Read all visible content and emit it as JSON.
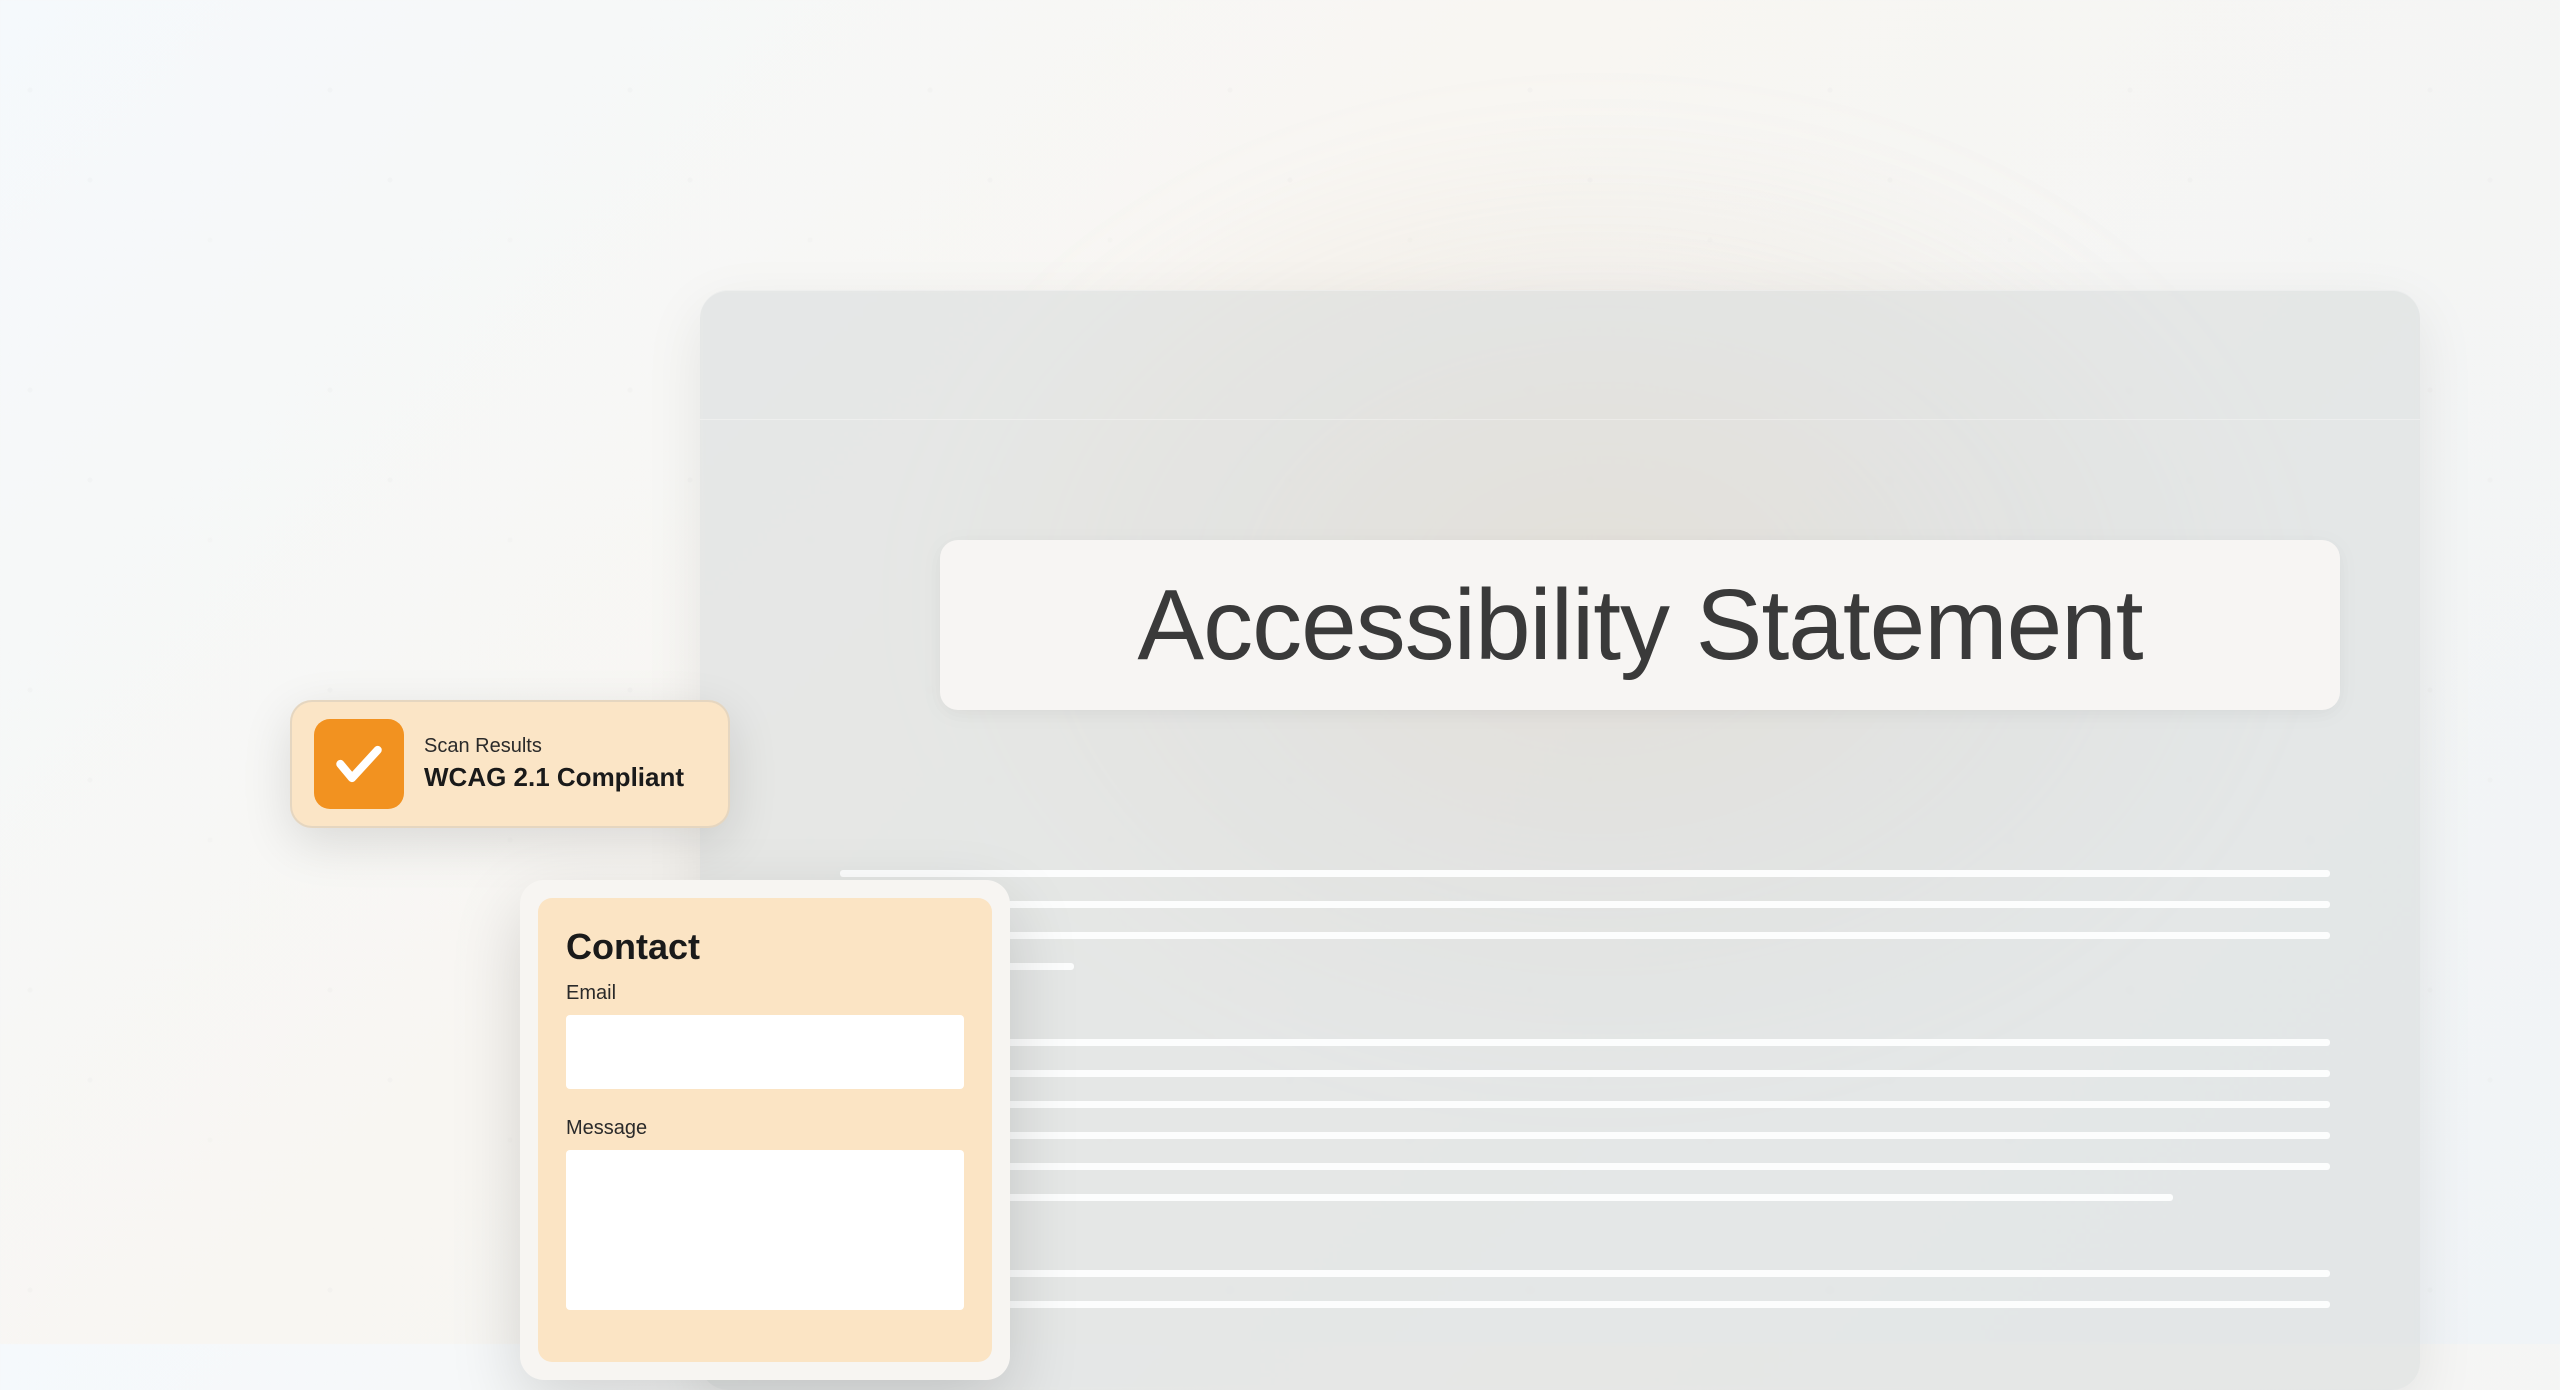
{
  "document": {
    "title": "Accessibility Statement"
  },
  "scan": {
    "label": "Scan Results",
    "value": "WCAG 2.1 Compliant"
  },
  "contact": {
    "title": "Contact",
    "email_label": "Email",
    "message_label": "Message"
  },
  "colors": {
    "accent": "#f29220",
    "badge_bg": "#fbe5c6"
  }
}
